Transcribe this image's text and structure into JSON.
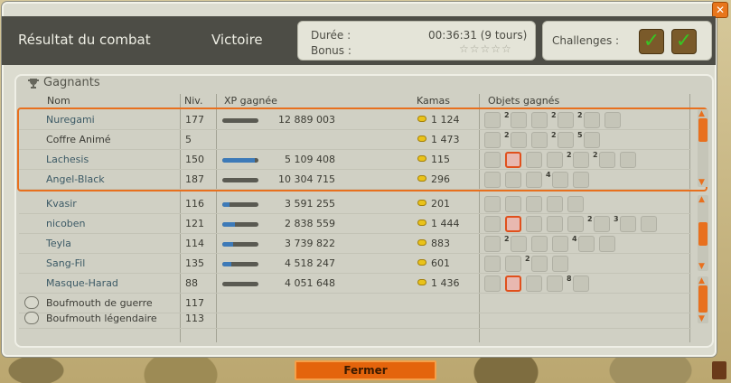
{
  "header": {
    "title": "Résultat du combat",
    "result": "Victoire",
    "duration_label": "Durée :",
    "duration_value": "00:36:31 (9 tours)",
    "bonus_label": "Bonus :",
    "bonus_stars": "☆☆☆☆☆",
    "challenges_label": "Challenges :"
  },
  "panel": {
    "title": "Gagnants"
  },
  "columns": {
    "name": "Nom",
    "level": "Niv.",
    "xp": "XP gagnée",
    "kamas": "Kamas",
    "items": "Objets gagnés"
  },
  "rows": [
    {
      "name": "Nuregami",
      "level": "177",
      "xp": "12 889 003",
      "xp_fill": 0,
      "kamas": "1 124",
      "items": [
        "hat",
        "2",
        "coin",
        "boot",
        "2",
        "amulet",
        "2",
        "flask",
        "stick"
      ],
      "style": "player"
    },
    {
      "name": "Coffre Animé",
      "level": "5",
      "xp": "",
      "xp_fill": null,
      "kamas": "1 473",
      "items": [
        "hat",
        "2",
        "coin",
        "boot",
        "2",
        "amulet",
        "5",
        "flask"
      ],
      "style": "plain"
    },
    {
      "name": "Lachesis",
      "level": "150",
      "xp": "5 109 408",
      "xp_fill": 90,
      "kamas": "115",
      "items": [
        "hat",
        "card",
        "coin",
        "boot",
        "2",
        "amulet",
        "2",
        "flask",
        "ring"
      ],
      "style": "player"
    },
    {
      "name": "Angel-Black",
      "level": "187",
      "xp": "10 304 715",
      "xp_fill": 0,
      "kamas": "296",
      "items": [
        "hat",
        "bag",
        "coin",
        "4",
        "flask",
        "bow"
      ],
      "style": "player"
    },
    {
      "name": "Kvasir",
      "level": "116",
      "xp": "3 591 255",
      "xp_fill": 20,
      "kamas": "201",
      "items": [
        "hat",
        "hat",
        "boot",
        "amulet",
        "flask"
      ],
      "style": "player"
    },
    {
      "name": "nicoben",
      "level": "121",
      "xp": "2 838 559",
      "xp_fill": 35,
      "kamas": "1 444",
      "items": [
        "hat",
        "card",
        "wing",
        "hat",
        "boot",
        "2",
        "amulet",
        "3",
        "flask",
        "ring"
      ],
      "style": "player"
    },
    {
      "name": "Teyla",
      "level": "114",
      "xp": "3 739 822",
      "xp_fill": 30,
      "kamas": "883",
      "items": [
        "hat",
        "2",
        "coin",
        "boot",
        "amulet",
        "4",
        "flask",
        "pick"
      ],
      "style": "player"
    },
    {
      "name": "Sang-Fil",
      "level": "135",
      "xp": "4 518 247",
      "xp_fill": 25,
      "kamas": "601",
      "items": [
        "hat",
        "coin",
        "2",
        "amulet",
        "pick"
      ],
      "style": "player"
    },
    {
      "name": "Masque-Harad",
      "level": "88",
      "xp": "4 051 648",
      "xp_fill": 0,
      "kamas": "1 436",
      "items": [
        "hat",
        "card",
        "hat",
        "ring",
        "8",
        "leaf"
      ],
      "style": "player"
    },
    {
      "name": "Boufmouth de guerre",
      "level": "117",
      "xp": "",
      "xp_fill": null,
      "kamas": "",
      "items": [],
      "style": "monster"
    },
    {
      "name": "Boufmouth légendaire",
      "level": "113",
      "xp": "",
      "xp_fill": null,
      "kamas": "",
      "items": [],
      "style": "monster"
    }
  ],
  "footer": {
    "close_label": "Fermer"
  },
  "colors": {
    "accent": "#e8701e",
    "header_bg": "#4d4d46",
    "xp_fill": "#3d7ab8",
    "check": "#39c424"
  }
}
